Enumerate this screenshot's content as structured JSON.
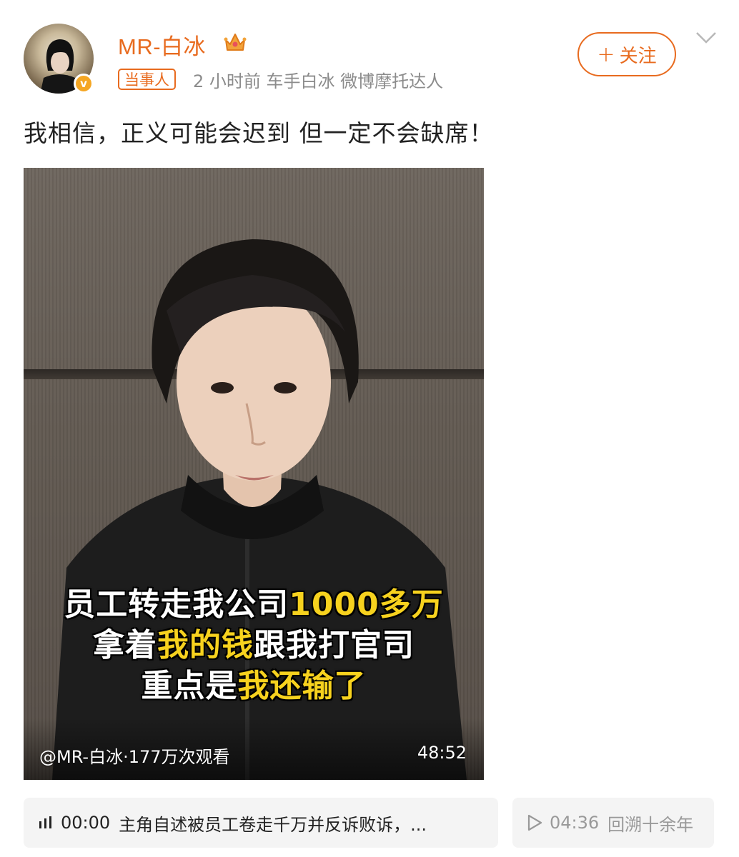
{
  "post": {
    "username": "MR-白冰",
    "tag": "当事人",
    "meta": "2 小时前   车手白冰 微博摩托达人",
    "follow_label": "关注",
    "text": "我相信，正义可能会迟到 但一定不会缺席！"
  },
  "video": {
    "caption_lines": [
      {
        "normal": "员工转走我公司",
        "highlight": "1000多万",
        "after": ""
      },
      {
        "normal": "拿着",
        "highlight": "我的钱",
        "after": "跟我打官司"
      },
      {
        "normal": "重点是",
        "highlight": "我还输了",
        "after": ""
      }
    ],
    "author_views": "@MR-白冰·177万次观看",
    "duration": "48:52"
  },
  "chapters": [
    {
      "time": "00:00",
      "title": "主角自述被员工卷走千万并反诉败诉，...",
      "icon": "playing-bars-icon"
    },
    {
      "time": "04:36",
      "title": "回溯十余年",
      "icon": "play-icon"
    }
  ],
  "colors": {
    "accent": "#e86b1f",
    "caption_highlight": "#f7d21e",
    "badge": "#f5a623"
  }
}
